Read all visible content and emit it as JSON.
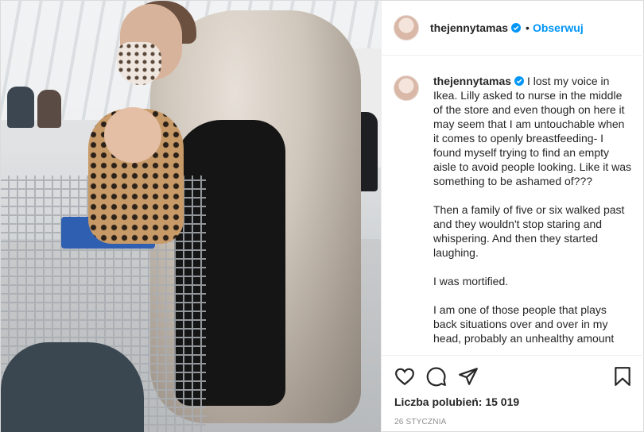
{
  "post": {
    "username": "thejennytamas",
    "follow_label": "Obserwuj",
    "separator": "•",
    "caption_paragraphs": [
      "I lost my voice in Ikea. Lilly asked to nurse in the middle of the store and even though on here it may seem that I am untouchable when it comes to openly breastfeeding- I found myself trying to find an empty aisle to avoid people looking. Like it was something to be ashamed of???",
      "Then a family of five or six walked past and they wouldn't stop staring and whispering. And then they started laughing.",
      "I was mortified.",
      "I am one of those people that plays back situations over and over in my head, probably an unhealthy amount"
    ],
    "likes_text": "Liczba polubień: 15 019",
    "date": "26 STYCZNIA"
  },
  "icons": {
    "verified": "verified-badge-icon",
    "like": "heart-icon",
    "comment": "comment-bubble-icon",
    "share": "paper-plane-icon",
    "save": "bookmark-icon"
  },
  "colors": {
    "accent": "#0095f6",
    "text": "#262626",
    "muted": "#8e8e8e",
    "border": "#dbdbdb"
  }
}
